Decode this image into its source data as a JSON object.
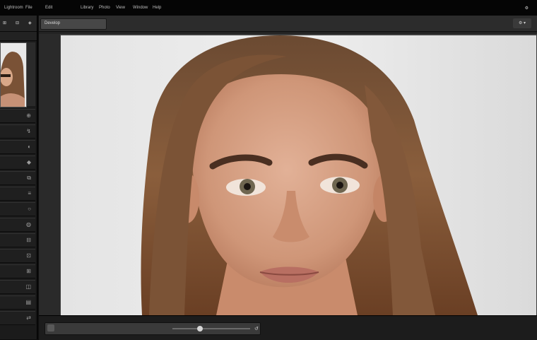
{
  "menubar": {
    "items": [
      "Lightroom",
      "File",
      "Edit",
      "Library",
      "Photo",
      "View",
      "Window",
      "Help"
    ],
    "app_title": "",
    "right_label": "⚙"
  },
  "left_panel": {
    "tabs": [
      "⊞",
      "⊟",
      "◈"
    ],
    "rows": [
      {
        "glyph": "⊕",
        "label": ""
      },
      {
        "glyph": "↯",
        "label": ""
      },
      {
        "glyph": "◐",
        "label": ""
      },
      {
        "glyph": "◆",
        "label": ""
      },
      {
        "glyph": "⧉",
        "label": ""
      },
      {
        "glyph": "≡",
        "label": ""
      },
      {
        "glyph": "○",
        "label": ""
      },
      {
        "glyph": "◍",
        "label": ""
      },
      {
        "glyph": "⊟",
        "label": ""
      },
      {
        "glyph": "⊡",
        "label": ""
      },
      {
        "glyph": "⊞",
        "label": ""
      },
      {
        "glyph": "◫",
        "label": ""
      },
      {
        "glyph": "▤",
        "label": ""
      },
      {
        "glyph": "⇄",
        "label": ""
      }
    ]
  },
  "toolbar": {
    "tab_label": "Develop",
    "right_label": "⚙ ▾"
  },
  "bottombar": {
    "label": "",
    "zoom": "",
    "slider_value": 0.35,
    "icons": [
      "↺",
      "⇲"
    ]
  },
  "colors": {
    "background": "#0d0d0d",
    "panel": "#1b1b1b",
    "canvas": "#3d3d3d"
  }
}
